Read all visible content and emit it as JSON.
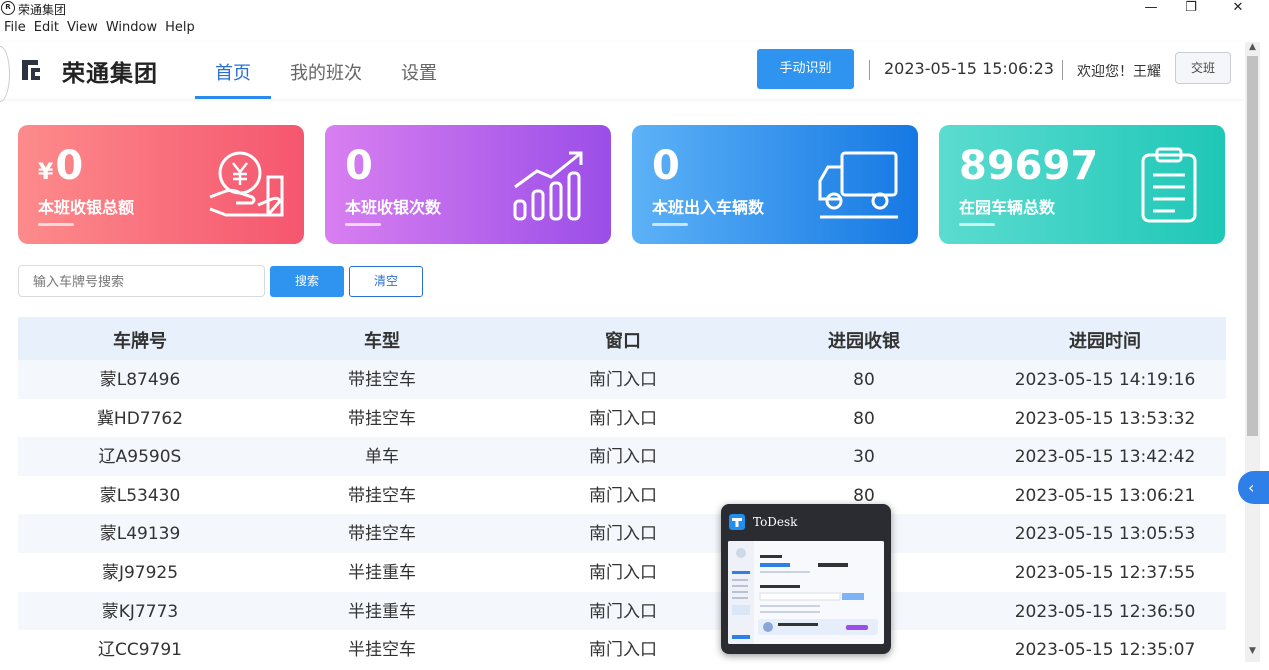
{
  "window": {
    "title": "荣通集团",
    "app_icon_glyph": "R",
    "controls": {
      "minimize": "—",
      "maximize": "❐",
      "close": "✕"
    }
  },
  "menu": [
    "File",
    "Edit",
    "View",
    "Window",
    "Help"
  ],
  "header": {
    "brand": "荣通集团",
    "nav": [
      "首页",
      "我的班次",
      "设置"
    ],
    "recognize_button": "手动识别",
    "datetime": "2023-05-15 15:06:23",
    "welcome": "欢迎您！王耀",
    "handover_button": "交班"
  },
  "stats": [
    {
      "currency": "¥",
      "value": "0",
      "label": "本班收银总额",
      "icon": "money-hand-icon"
    },
    {
      "currency": "",
      "value": "0",
      "label": "本班收银次数",
      "icon": "growth-chart-icon"
    },
    {
      "currency": "",
      "value": "0",
      "label": "本班出入车辆数",
      "icon": "truck-icon"
    },
    {
      "currency": "",
      "value": "89697",
      "label": "在园车辆总数",
      "icon": "clipboard-icon"
    }
  ],
  "search": {
    "placeholder": "输入车牌号搜索",
    "search_button": "搜索",
    "clear_button": "清空"
  },
  "table": {
    "headers": [
      "车牌号",
      "车型",
      "窗口",
      "进园收银",
      "进园时间"
    ],
    "rows": [
      [
        "蒙L87496",
        "带挂空车",
        "南门入口",
        "80",
        "2023-05-15 14:19:16"
      ],
      [
        "冀HD7762",
        "带挂空车",
        "南门入口",
        "80",
        "2023-05-15 13:53:32"
      ],
      [
        "辽A9590S",
        "单车",
        "南门入口",
        "30",
        "2023-05-15 13:42:42"
      ],
      [
        "蒙L53430",
        "带挂空车",
        "南门入口",
        "80",
        "2023-05-15 13:06:21"
      ],
      [
        "蒙L49139",
        "带挂空车",
        "南门入口",
        "",
        "2023-05-15 13:05:53"
      ],
      [
        "蒙J97925",
        "半挂重车",
        "南门入口",
        "",
        "2023-05-15 12:37:55"
      ],
      [
        "蒙KJ7773",
        "半挂重车",
        "南门入口",
        "",
        "2023-05-15 12:36:50"
      ],
      [
        "辽CC9791",
        "半挂空车",
        "南门入口",
        "",
        "2023-05-15 12:35:07"
      ]
    ]
  },
  "popup": {
    "title": "ToDesk"
  },
  "colors": {
    "accent": "#2f93f0",
    "card1": "#f5566f",
    "card2": "#9b4ee8",
    "card3": "#1578e3",
    "card4": "#1fc7b7"
  }
}
